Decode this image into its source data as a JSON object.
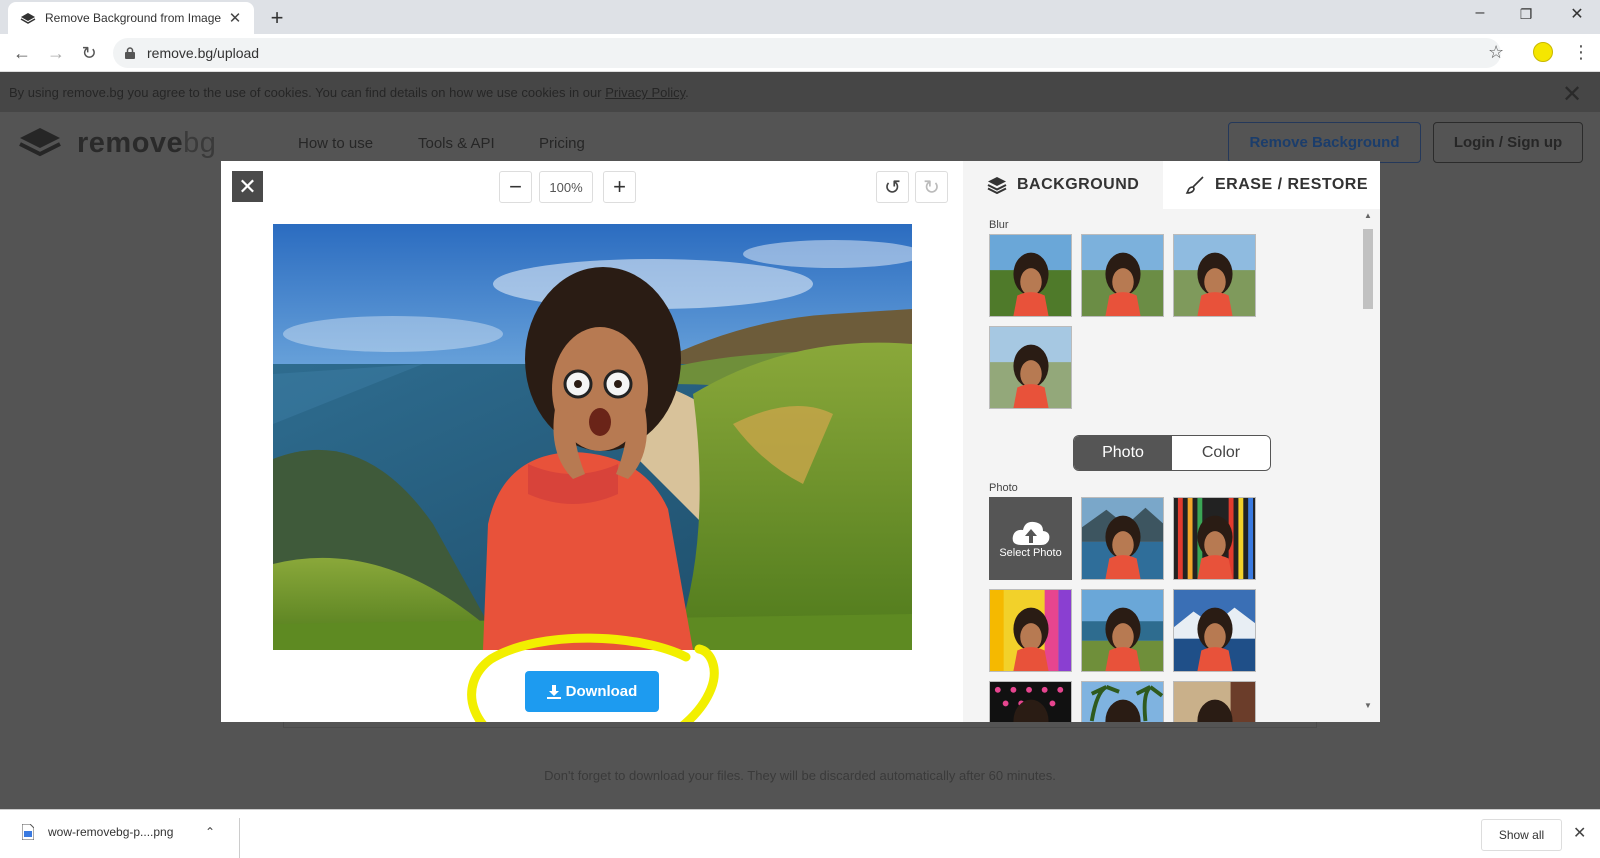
{
  "browser": {
    "tab_title": "Remove Background from Image",
    "tab_close": "✕",
    "new_tab": "+",
    "url": "remove.bg/upload",
    "window_controls": [
      "–",
      "❐",
      "✕"
    ]
  },
  "cookie_bar": {
    "text": "By using remove.bg you agree to the use of cookies. You can find details on how we use cookies in our ",
    "link": "Privacy Policy",
    "suffix": ".",
    "close": "✕"
  },
  "site_nav": {
    "logo_main": "remove",
    "logo_suffix": "bg",
    "links": [
      "How to use",
      "Tools & API",
      "Pricing"
    ],
    "cta": "Remove Background",
    "login": "Login / Sign up"
  },
  "page": {
    "discard_notice": "Don't forget to download your files. They will be discarded automatically after 60 minutes."
  },
  "editor": {
    "close": "✕",
    "zoom_out": "−",
    "zoom_level": "100%",
    "zoom_in": "+",
    "download_label": "Download",
    "highlight_color": "#f2ef00",
    "accent_color": "#1d9bf0"
  },
  "sidebar": {
    "tab_background": "BACKGROUND",
    "tab_erase": "ERASE / RESTORE",
    "blur_section": "Blur",
    "toggle_photo": "Photo",
    "toggle_color": "Color",
    "photo_section": "Photo",
    "select_photo": "Select Photo"
  },
  "download_shelf": {
    "file_name": "wow-removebg-p....png",
    "show_all": "Show all",
    "close": "✕"
  }
}
